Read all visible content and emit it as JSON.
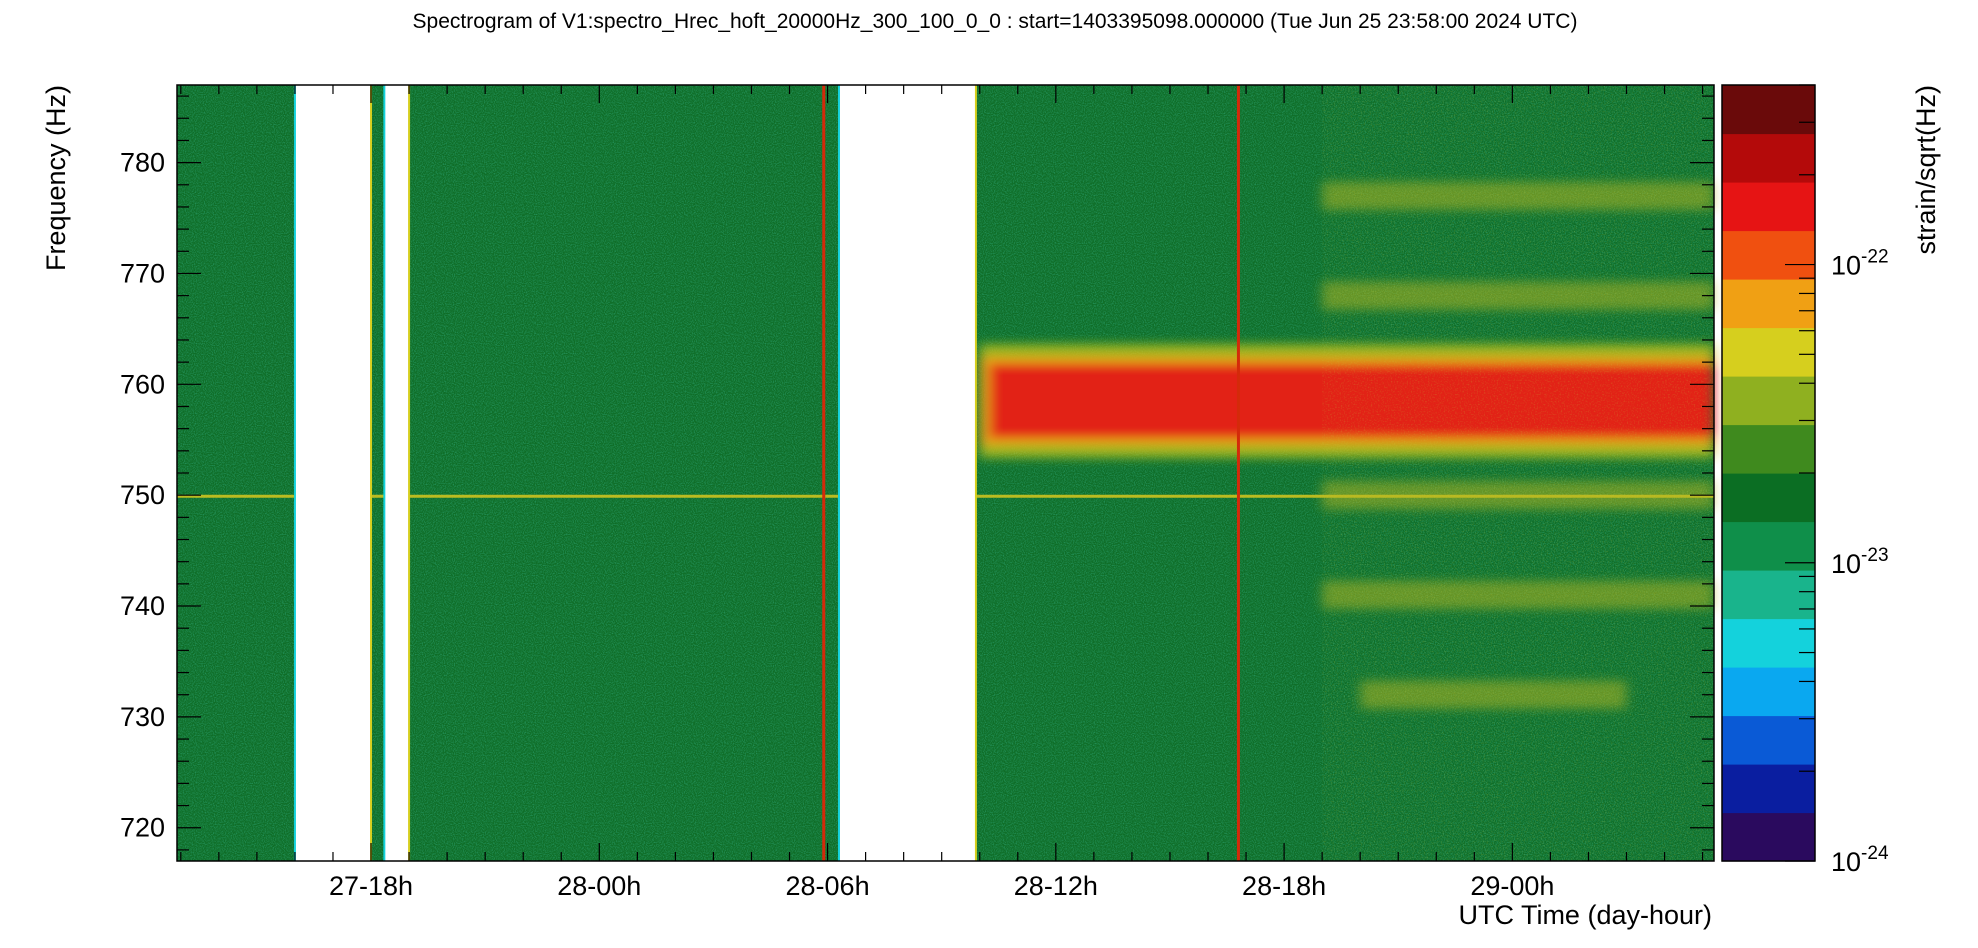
{
  "chart_data": {
    "type": "heatmap",
    "title": "Spectrogram of V1:spectro_Hrec_hoft_20000Hz_300_100_0_0 : start=1403395098.000000 (Tue Jun 25 23:58:00 2024 UTC)",
    "xlabel": "UTC Time (day-hour)",
    "ylabel": "Frequency (Hz)",
    "colorbar_label": "strain/sqrt(Hz)",
    "xlim": [
      12.9,
      53.3
    ],
    "ylim": [
      717,
      787
    ],
    "x_ticks": [
      {
        "value": 18,
        "label": "27-18h"
      },
      {
        "value": 24,
        "label": "28-00h"
      },
      {
        "value": 30,
        "label": "28-06h"
      },
      {
        "value": 36,
        "label": "28-12h"
      },
      {
        "value": 42,
        "label": "28-18h"
      },
      {
        "value": 48,
        "label": "29-00h"
      }
    ],
    "y_ticks": [
      720,
      730,
      740,
      750,
      760,
      770,
      780
    ],
    "colorbar": {
      "scale": "log",
      "range": [
        1e-24,
        4e-22
      ],
      "ticks": [
        {
          "value": 1e-24,
          "base": "10",
          "exp": "-24"
        },
        {
          "value": 1e-23,
          "base": "10",
          "exp": "-23"
        },
        {
          "value": 1e-22,
          "base": "10",
          "exp": "-22"
        }
      ],
      "colors": [
        "#2a0a5e",
        "#0a1ea0",
        "#0a5ad6",
        "#0aa8f0",
        "#14d2dc",
        "#19b48c",
        "#0f8f4a",
        "#0b6e23",
        "#3f8a1e",
        "#8fb020",
        "#d6cf1e",
        "#f0a014",
        "#f05010",
        "#e61414",
        "#b40a0a",
        "#6a0a0a"
      ]
    },
    "gaps": [
      {
        "start": 16.0,
        "end": 18.0
      },
      {
        "start": 18.35,
        "end": 19.0
      },
      {
        "start": 30.3,
        "end": 33.9
      }
    ],
    "vertical_glitches": [
      {
        "time": 29.9,
        "level": "red"
      },
      {
        "time": 40.8,
        "level": "red"
      }
    ],
    "lines": [
      {
        "name": "750 Hz line",
        "freq": 749.9,
        "start": 12.9,
        "end": 53.3
      },
      {
        "name": "758 Hz band",
        "freq_min": 755,
        "freq_max": 762,
        "start": 34.0,
        "end": 53.3
      },
      {
        "name": "side band upper",
        "freq": 777,
        "start": 43.0,
        "end": 53.3
      },
      {
        "name": "side band",
        "freq": 768,
        "start": 43.0,
        "end": 53.3
      },
      {
        "name": "side band lower",
        "freq": 750,
        "start": 43.0,
        "end": 53.3
      },
      {
        "name": "side band lower",
        "freq": 741,
        "start": 43.0,
        "end": 53.3
      },
      {
        "name": "side band lower",
        "freq": 732,
        "start": 44.0,
        "end": 51.0
      }
    ]
  }
}
